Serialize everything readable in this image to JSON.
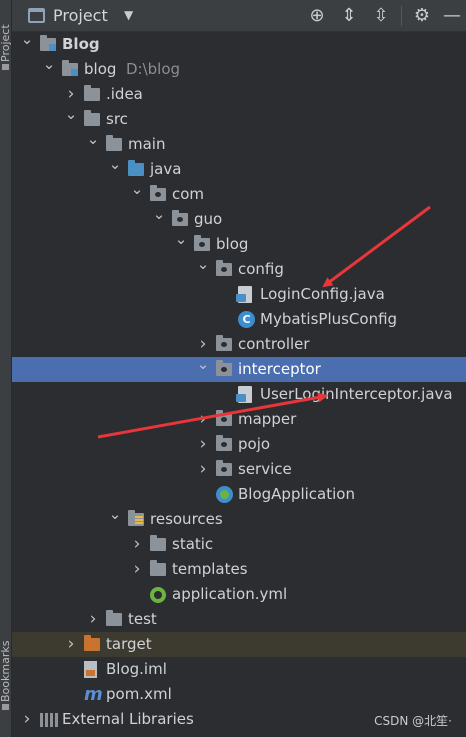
{
  "side_strip": {
    "top_label": "Project",
    "bottom_label": "Bookmarks"
  },
  "header": {
    "title": "Project",
    "caret": "▼"
  },
  "toolbar_icons": [
    "locate-icon",
    "expand-all-icon",
    "collapse-all-icon",
    "gear-icon",
    "hide-icon"
  ],
  "tree": [
    {
      "label": "Blog",
      "depth": 0,
      "expanded": true,
      "icon": "module-folder",
      "bold": true
    },
    {
      "label": "blog",
      "path": "D:\\blog",
      "depth": 1,
      "expanded": true,
      "icon": "module-folder"
    },
    {
      "label": ".idea",
      "depth": 2,
      "expanded": false,
      "icon": "folder"
    },
    {
      "label": "src",
      "depth": 2,
      "expanded": true,
      "icon": "folder"
    },
    {
      "label": "main",
      "depth": 3,
      "expanded": true,
      "icon": "folder"
    },
    {
      "label": "java",
      "depth": 4,
      "expanded": true,
      "icon": "source-folder"
    },
    {
      "label": "com",
      "depth": 5,
      "expanded": true,
      "icon": "package"
    },
    {
      "label": "guo",
      "depth": 6,
      "expanded": true,
      "icon": "package"
    },
    {
      "label": "blog",
      "depth": 7,
      "expanded": true,
      "icon": "package"
    },
    {
      "label": "config",
      "depth": 8,
      "expanded": true,
      "icon": "package"
    },
    {
      "label": "LoginConfig.java",
      "depth": 9,
      "icon": "java-interface"
    },
    {
      "label": "MybatisPlusConfig",
      "depth": 9,
      "icon": "java-class"
    },
    {
      "label": "controller",
      "depth": 8,
      "expanded": false,
      "icon": "package"
    },
    {
      "label": "interceptor",
      "depth": 8,
      "expanded": true,
      "icon": "package",
      "selected": true
    },
    {
      "label": "UserLoginInterceptor.java",
      "depth": 9,
      "icon": "java-interface"
    },
    {
      "label": "mapper",
      "depth": 8,
      "expanded": false,
      "icon": "package"
    },
    {
      "label": "pojo",
      "depth": 8,
      "expanded": false,
      "icon": "package"
    },
    {
      "label": "service",
      "depth": 8,
      "expanded": false,
      "icon": "package"
    },
    {
      "label": "BlogApplication",
      "depth": 8,
      "icon": "spring-app"
    },
    {
      "label": "resources",
      "depth": 4,
      "expanded": true,
      "icon": "resources-folder"
    },
    {
      "label": "static",
      "depth": 5,
      "expanded": false,
      "icon": "folder"
    },
    {
      "label": "templates",
      "depth": 5,
      "expanded": false,
      "icon": "folder"
    },
    {
      "label": "application.yml",
      "depth": 5,
      "icon": "yml-file"
    },
    {
      "label": "test",
      "depth": 3,
      "expanded": false,
      "icon": "folder"
    },
    {
      "label": "target",
      "depth": 2,
      "expanded": false,
      "icon": "excluded-folder",
      "band": true
    },
    {
      "label": "Blog.iml",
      "depth": 2,
      "icon": "iml-file"
    },
    {
      "label": "pom.xml",
      "depth": 2,
      "icon": "maven-file"
    },
    {
      "label": "External Libraries",
      "depth": 0,
      "expanded": false,
      "icon": "libraries"
    }
  ],
  "watermark": "CSDN @北笙·",
  "colors": {
    "selection": "#4b6eaf",
    "arrow": "#e8363a",
    "background": "#2b2d30"
  }
}
